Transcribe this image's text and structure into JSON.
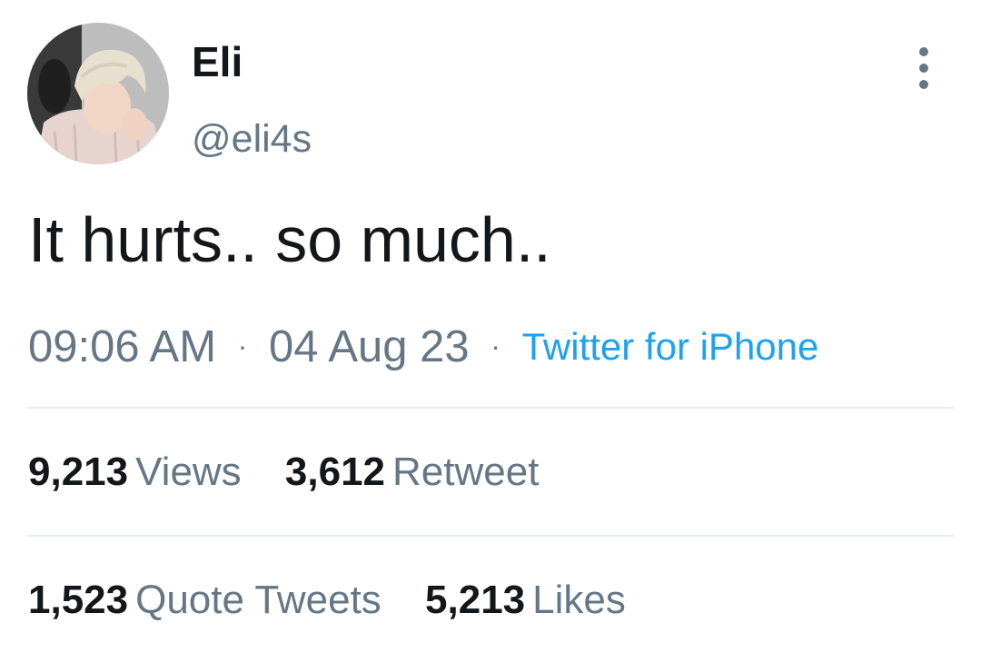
{
  "author": {
    "display_name": "Eli",
    "handle": "@eli4s"
  },
  "icons": {
    "more": "more-vertical-icon",
    "avatar": "profile-photo"
  },
  "tweet": {
    "text": "It hurts.. so much..",
    "time": "09:06 AM",
    "separator": "·",
    "date": "04 Aug 23",
    "source": "Twitter for iPhone"
  },
  "stats": {
    "views": {
      "count": "9,213",
      "label": "Views"
    },
    "retweets": {
      "count": "3,612",
      "label": "Retweet"
    },
    "quote_tweets": {
      "count": "1,523",
      "label": "Quote Tweets"
    },
    "likes": {
      "count": "5,213",
      "label": "Likes"
    }
  },
  "colors": {
    "primary_text": "#14171a",
    "secondary_text": "#657786",
    "link": "#1da1f2",
    "divider": "#e6ecf0"
  }
}
